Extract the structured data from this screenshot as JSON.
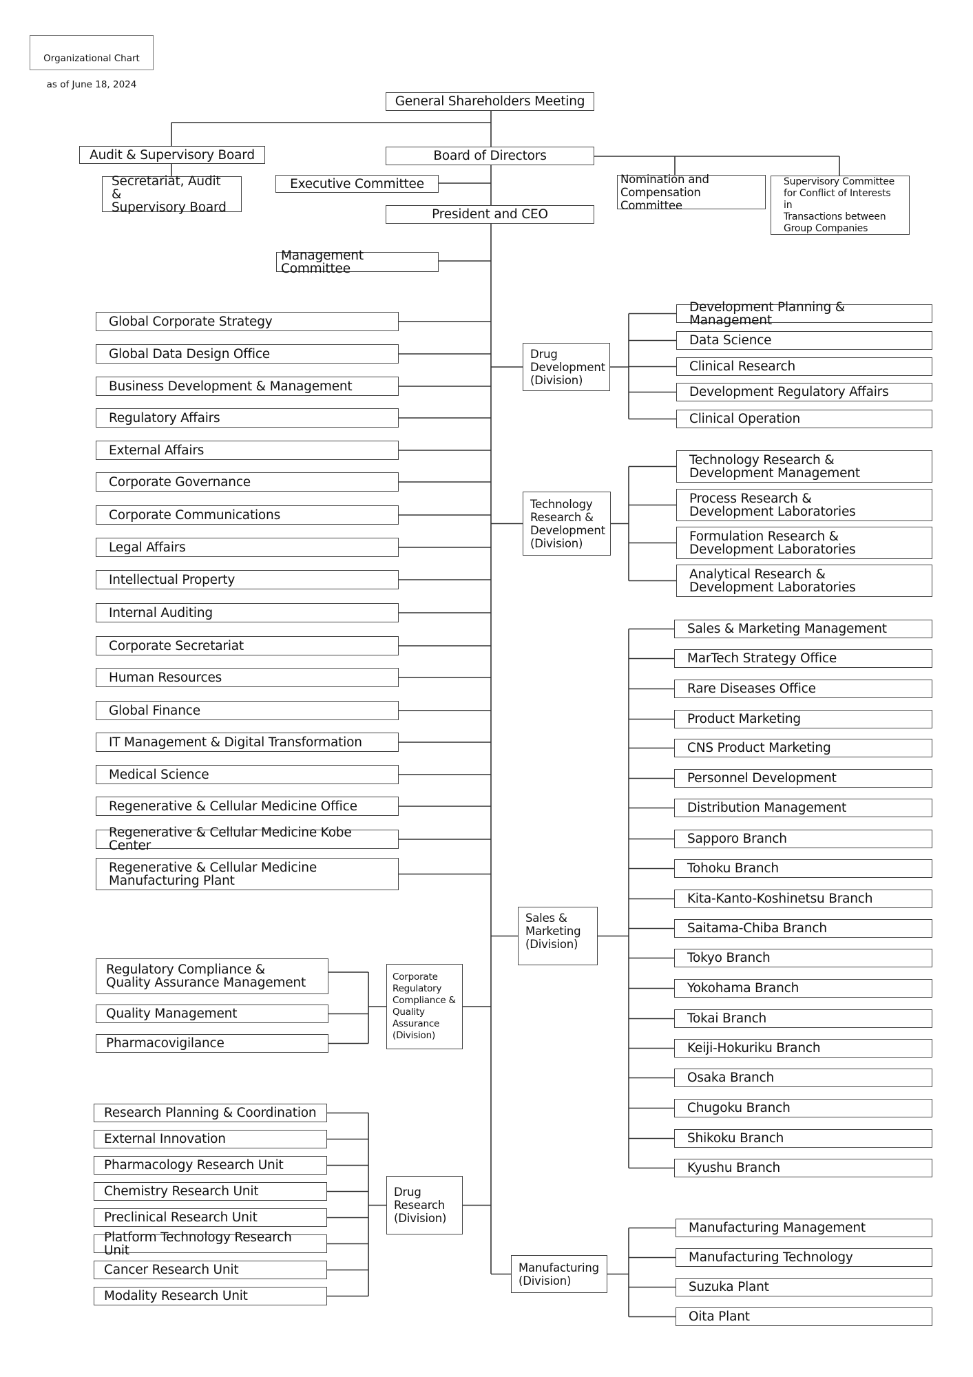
{
  "title": {
    "line1": "Organizational Chart",
    "line2": "as of June 18, 2024"
  },
  "governance": {
    "shareholders": "General Shareholders Meeting",
    "audit_board": "Audit & Supervisory Board",
    "audit_secretariat": "Secretariat, Audit &\nSupervisory Board",
    "board": "Board of Directors",
    "executive_committee": "Executive Committee",
    "nomination_committee": "Nomination and\nCompensation Committee",
    "conflict_committee": "Supervisory Committee\nfor Conflict of Interests in\nTransactions between\nGroup Companies",
    "ceo": "President and CEO",
    "management_committee": "Management Committee"
  },
  "corporate_departments": [
    "Global Corporate Strategy",
    "Global Data Design Office",
    "Business Development & Management",
    "Regulatory Affairs",
    "External Affairs",
    "Corporate Governance",
    "Corporate Communications",
    "Legal Affairs",
    "Intellectual Property",
    "Internal Auditing",
    "Corporate Secretariat",
    "Human Resources",
    "Global Finance",
    "IT Management & Digital Transformation",
    "Medical Science",
    "Regenerative & Cellular Medicine Office",
    "Regenerative & Cellular Medicine Kobe Center",
    "Regenerative & Cellular Medicine\nManufacturing Plant"
  ],
  "divisions": {
    "drug_development": {
      "name": "Drug\nDevelopment\n(Division)",
      "units": [
        "Development Planning & Management",
        "Data Science",
        "Clinical Research",
        "Development Regulatory Affairs",
        "Clinical Operation"
      ]
    },
    "technology_rd": {
      "name": "Technology\nResearch &\nDevelopment\n(Division)",
      "units": [
        "Technology Research &\nDevelopment Management",
        "Process Research &\nDevelopment Laboratories",
        "Formulation Research &\nDevelopment Laboratories",
        "Analytical Research &\nDevelopment Laboratories"
      ]
    },
    "sales_marketing": {
      "name": "Sales &\nMarketing\n(Division)",
      "units": [
        "Sales & Marketing Management",
        "MarTech Strategy Office",
        "Rare Diseases Office",
        "Product Marketing",
        "CNS Product Marketing",
        "Personnel Development",
        "Distribution Management",
        "Sapporo Branch",
        "Tohoku Branch",
        "Kita-Kanto-Koshinetsu Branch",
        "Saitama-Chiba Branch",
        "Tokyo Branch",
        "Yokohama Branch",
        "Tokai Branch",
        "Keiji-Hokuriku Branch",
        "Osaka Branch",
        "Chugoku Branch",
        "Shikoku Branch",
        "Kyushu Branch"
      ]
    },
    "regulatory_quality": {
      "name": "Corporate\nRegulatory\nCompliance &\nQuality\nAssurance\n(Division)",
      "units": [
        "Regulatory Compliance &\nQuality Assurance Management",
        "Quality Management",
        "Pharmacovigilance"
      ]
    },
    "drug_research": {
      "name": "Drug\nResearch\n(Division)",
      "units": [
        "Research Planning & Coordination",
        "External Innovation",
        "Pharmacology Research Unit",
        "Chemistry Research Unit",
        "Preclinical Research Unit",
        "Platform Technology Research Unit",
        "Cancer Research Unit",
        "Modality Research Unit"
      ]
    },
    "manufacturing": {
      "name": "Manufacturing\n(Division)",
      "units": [
        "Manufacturing Management",
        "Manufacturing Technology",
        "Suzuka Plant",
        "Oita Plant"
      ]
    }
  }
}
